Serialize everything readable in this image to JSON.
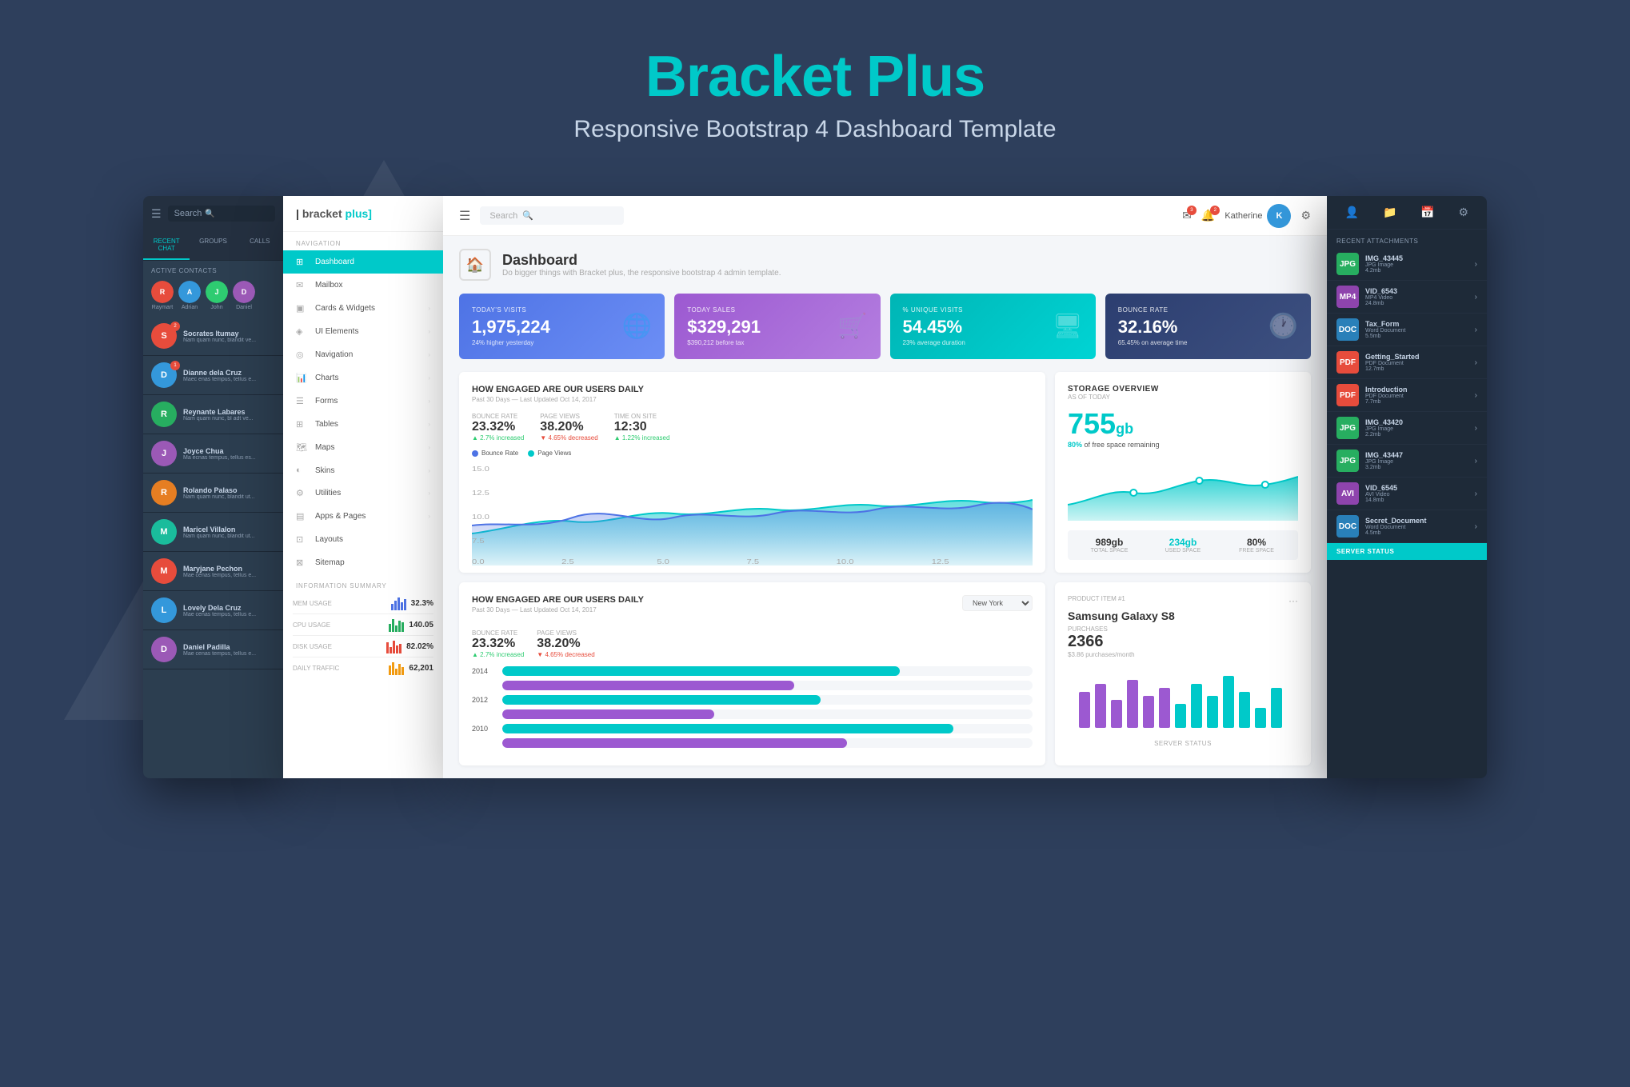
{
  "page": {
    "title": "Bracket Plus",
    "subtitle_bold": "Bracket Plus",
    "subtitle_description": "Responsive Bootstrap 4 Dashboard Template"
  },
  "app": {
    "logo": "bracket plus",
    "logo_bracket": "bracket",
    "logo_plus": " plus]"
  },
  "chat_panel": {
    "search_placeholder": "Search",
    "tabs": [
      "RECENT CHAT",
      "GROUPS",
      "CALLS"
    ],
    "active_tab": "RECENT CHAT",
    "active_contacts_label": "ACTIVE CONTACTS",
    "active_contacts": [
      {
        "name": "Raymart",
        "initial": "R",
        "color": "#e74c3c"
      },
      {
        "name": "Adrian",
        "initial": "A",
        "color": "#3498db"
      },
      {
        "name": "John",
        "initial": "J",
        "color": "#2ecc71"
      },
      {
        "name": "Daniel",
        "initial": "D",
        "color": "#9b59b6"
      }
    ],
    "chats": [
      {
        "name": "Socrates Itumay",
        "msg": "Nam quam nunc, blandit ve...",
        "badge": "2",
        "color": "#e74c3c"
      },
      {
        "name": "Dianne dela Cruz",
        "msg": "Maec enas tempus, tellus e...",
        "badge": "1",
        "color": "#3498db"
      },
      {
        "name": "Reynante Labares",
        "msg": "Nam quam nunc, bl adt ve...",
        "badge": "",
        "color": "#27ae60"
      },
      {
        "name": "Joyce Chua",
        "msg": "Ma ecnas tempus, tellus es...",
        "badge": "",
        "color": "#9b59b6"
      },
      {
        "name": "Rolando Palaso",
        "msg": "Nam quam nunc, blandit ut...",
        "badge": "",
        "color": "#e67e22"
      },
      {
        "name": "Maricel Villalon",
        "msg": "Nam quam nunc, blandit ut...",
        "badge": "",
        "color": "#1abc9c"
      },
      {
        "name": "Maryjane Pechon",
        "msg": "Mae cenas tempus, tellus e...",
        "badge": "",
        "color": "#e74c3c"
      },
      {
        "name": "Lovely Dela Cruz",
        "msg": "Mae cenas tempus, tellus e...",
        "badge": "",
        "color": "#3498db"
      },
      {
        "name": "Daniel Padilla",
        "msg": "Mae cenas tempus, tellus e...",
        "badge": "",
        "color": "#9b59b6"
      }
    ]
  },
  "sidebar": {
    "section_label": "NAVIGATION",
    "items": [
      {
        "label": "Dashboard",
        "icon": "⊞",
        "active": true,
        "arrow": false
      },
      {
        "label": "Mailbox",
        "icon": "✉",
        "active": false,
        "arrow": false
      },
      {
        "label": "Cards & Widgets",
        "icon": "▣",
        "active": false,
        "arrow": true
      },
      {
        "label": "UI Elements",
        "icon": "◈",
        "active": false,
        "arrow": true
      },
      {
        "label": "Navigation",
        "icon": "◎",
        "active": false,
        "arrow": true
      },
      {
        "label": "Charts",
        "icon": "📊",
        "active": false,
        "arrow": true
      },
      {
        "label": "Forms",
        "icon": "☰",
        "active": false,
        "arrow": true
      },
      {
        "label": "Tables",
        "icon": "⊞",
        "active": false,
        "arrow": true
      },
      {
        "label": "Maps",
        "icon": "🗺",
        "active": false,
        "arrow": true
      },
      {
        "label": "Skins",
        "icon": "◐",
        "active": false,
        "arrow": true
      },
      {
        "label": "Utilities",
        "icon": "⚙",
        "active": false,
        "arrow": true
      },
      {
        "label": "Apps & Pages",
        "icon": "▤",
        "active": false,
        "arrow": true
      },
      {
        "label": "Layouts",
        "icon": "⊡",
        "active": false,
        "arrow": false
      },
      {
        "label": "Sitemap",
        "icon": "⊠",
        "active": false,
        "arrow": false
      }
    ]
  },
  "topnav": {
    "search_placeholder": "Search",
    "search_icon": "🔍",
    "user_name": "Katherine",
    "notifications": "2",
    "messages": "3"
  },
  "dashboard": {
    "page_title": "Dashboard",
    "page_subtitle": "Do bigger things with Bracket plus, the responsive bootstrap 4 admin template.",
    "stat_cards": [
      {
        "label": "TODAY'S VISITS",
        "value": "1,975,224",
        "sub": "24% higher yesterday",
        "icon": "🌐",
        "color_class": "stat-card-blue"
      },
      {
        "label": "TODAY SALES",
        "value": "$329,291",
        "sub": "$390,212 before tax",
        "icon": "🛒",
        "color_class": "stat-card-purple"
      },
      {
        "label": "% UNIQUE VISITS",
        "value": "54.45%",
        "sub": "23% average duration",
        "icon": "🖥",
        "color_class": "stat-card-teal"
      },
      {
        "label": "BOUNCE RATE",
        "value": "32.16%",
        "sub": "65.45% on average time",
        "icon": "🕐",
        "color_class": "stat-card-dark"
      }
    ],
    "engagement_chart": {
      "title": "HOW ENGAGED ARE OUR USERS DAILY",
      "sub": "Past 30 Days — Last Updated Oct 14, 2017",
      "metrics": [
        {
          "label": "BOUNCE RATE",
          "value": "23.32%",
          "change": "2.7% increased",
          "up": true
        },
        {
          "label": "PAGE VIEWS",
          "value": "38.20%",
          "change": "4.65% decreased",
          "up": false
        },
        {
          "label": "TIME ON SITE",
          "value": "12:30",
          "change": "1.22% increased",
          "up": true
        }
      ],
      "legend": [
        {
          "label": "Bounce Rate",
          "color": "#4e73e5"
        },
        {
          "label": "Page Views",
          "color": "#00c9c9"
        }
      ]
    },
    "storage": {
      "title": "STORAGE OVERVIEW",
      "sub": "AS OF TODAY",
      "value": "755",
      "unit": "gb",
      "percent_text": "80% of free space remaining",
      "total": "989gb",
      "used": "234gb",
      "free": "80%",
      "total_label": "TOTAL SPACE",
      "used_label": "USED SPACE",
      "free_label": "FREE SPACE"
    },
    "bottom_chart": {
      "title": "HOW ENGAGED ARE OUR USERS DAILY",
      "sub": "Past 30 Days — Last Updated Oct 14, 2017",
      "dropdown": "New York",
      "dropdown_label": "York",
      "metrics": [
        {
          "label": "BOUNCE RATE",
          "value": "23.32%",
          "change": "2.7% increased",
          "up": true
        },
        {
          "label": "PAGE VIEWS",
          "value": "38.20%",
          "change": "4.65% decreased",
          "up": false
        }
      ],
      "years": [
        "2014",
        "2012",
        "2010"
      ]
    },
    "product": {
      "tag": "PRODUCT ITEM #1",
      "name": "Samsung Galaxy S8",
      "purchases_label": "PURCHASES",
      "purchases_value": "2366",
      "purchases_sub": "$3.86 purchases/month"
    },
    "info_summary": {
      "title": "INFORMATION SUMMARY",
      "metrics": [
        {
          "label": "MEM USAGE",
          "value": "32.3%"
        },
        {
          "label": "CPU USAGE",
          "value": "140.05"
        },
        {
          "label": "DISK USAGE",
          "value": "82.02%"
        },
        {
          "label": "DAILY TRAFFIC",
          "value": "62,201"
        }
      ]
    }
  },
  "right_panel": {
    "section_label": "RECENT ATTACHMENTS",
    "attachments": [
      {
        "name": "IMG_43445",
        "meta": "JPG Image\n4.2mb",
        "type": "JPG",
        "color": "att-green"
      },
      {
        "name": "VID_6543",
        "meta": "MP4 Video\n24.8mb",
        "type": "MP4",
        "color": "att-purple"
      },
      {
        "name": "Tax_Form",
        "meta": "Word Document\n5.5mb",
        "type": "DOC",
        "color": "att-blue"
      },
      {
        "name": "Getting_Started",
        "meta": "PDF Document\n12.7mb",
        "type": "PDF",
        "color": "att-red"
      },
      {
        "name": "Introduction",
        "meta": "PDF Document\n7.7mb",
        "type": "PDF",
        "color": "att-red"
      },
      {
        "name": "IMG_43420",
        "meta": "JPG Image\n2.2mb",
        "type": "JPG",
        "color": "att-green"
      },
      {
        "name": "IMG_43447",
        "meta": "JPG Image\n3.2mb",
        "type": "JPG",
        "color": "att-green"
      },
      {
        "name": "VID_6545",
        "meta": "AVI Video\n14.8mb",
        "type": "AVI",
        "color": "att-purple"
      },
      {
        "name": "Secret_Document",
        "meta": "Word Document\n4.5mb",
        "type": "DOC",
        "color": "att-blue"
      }
    ],
    "server_status": "SERVER STATUS"
  }
}
